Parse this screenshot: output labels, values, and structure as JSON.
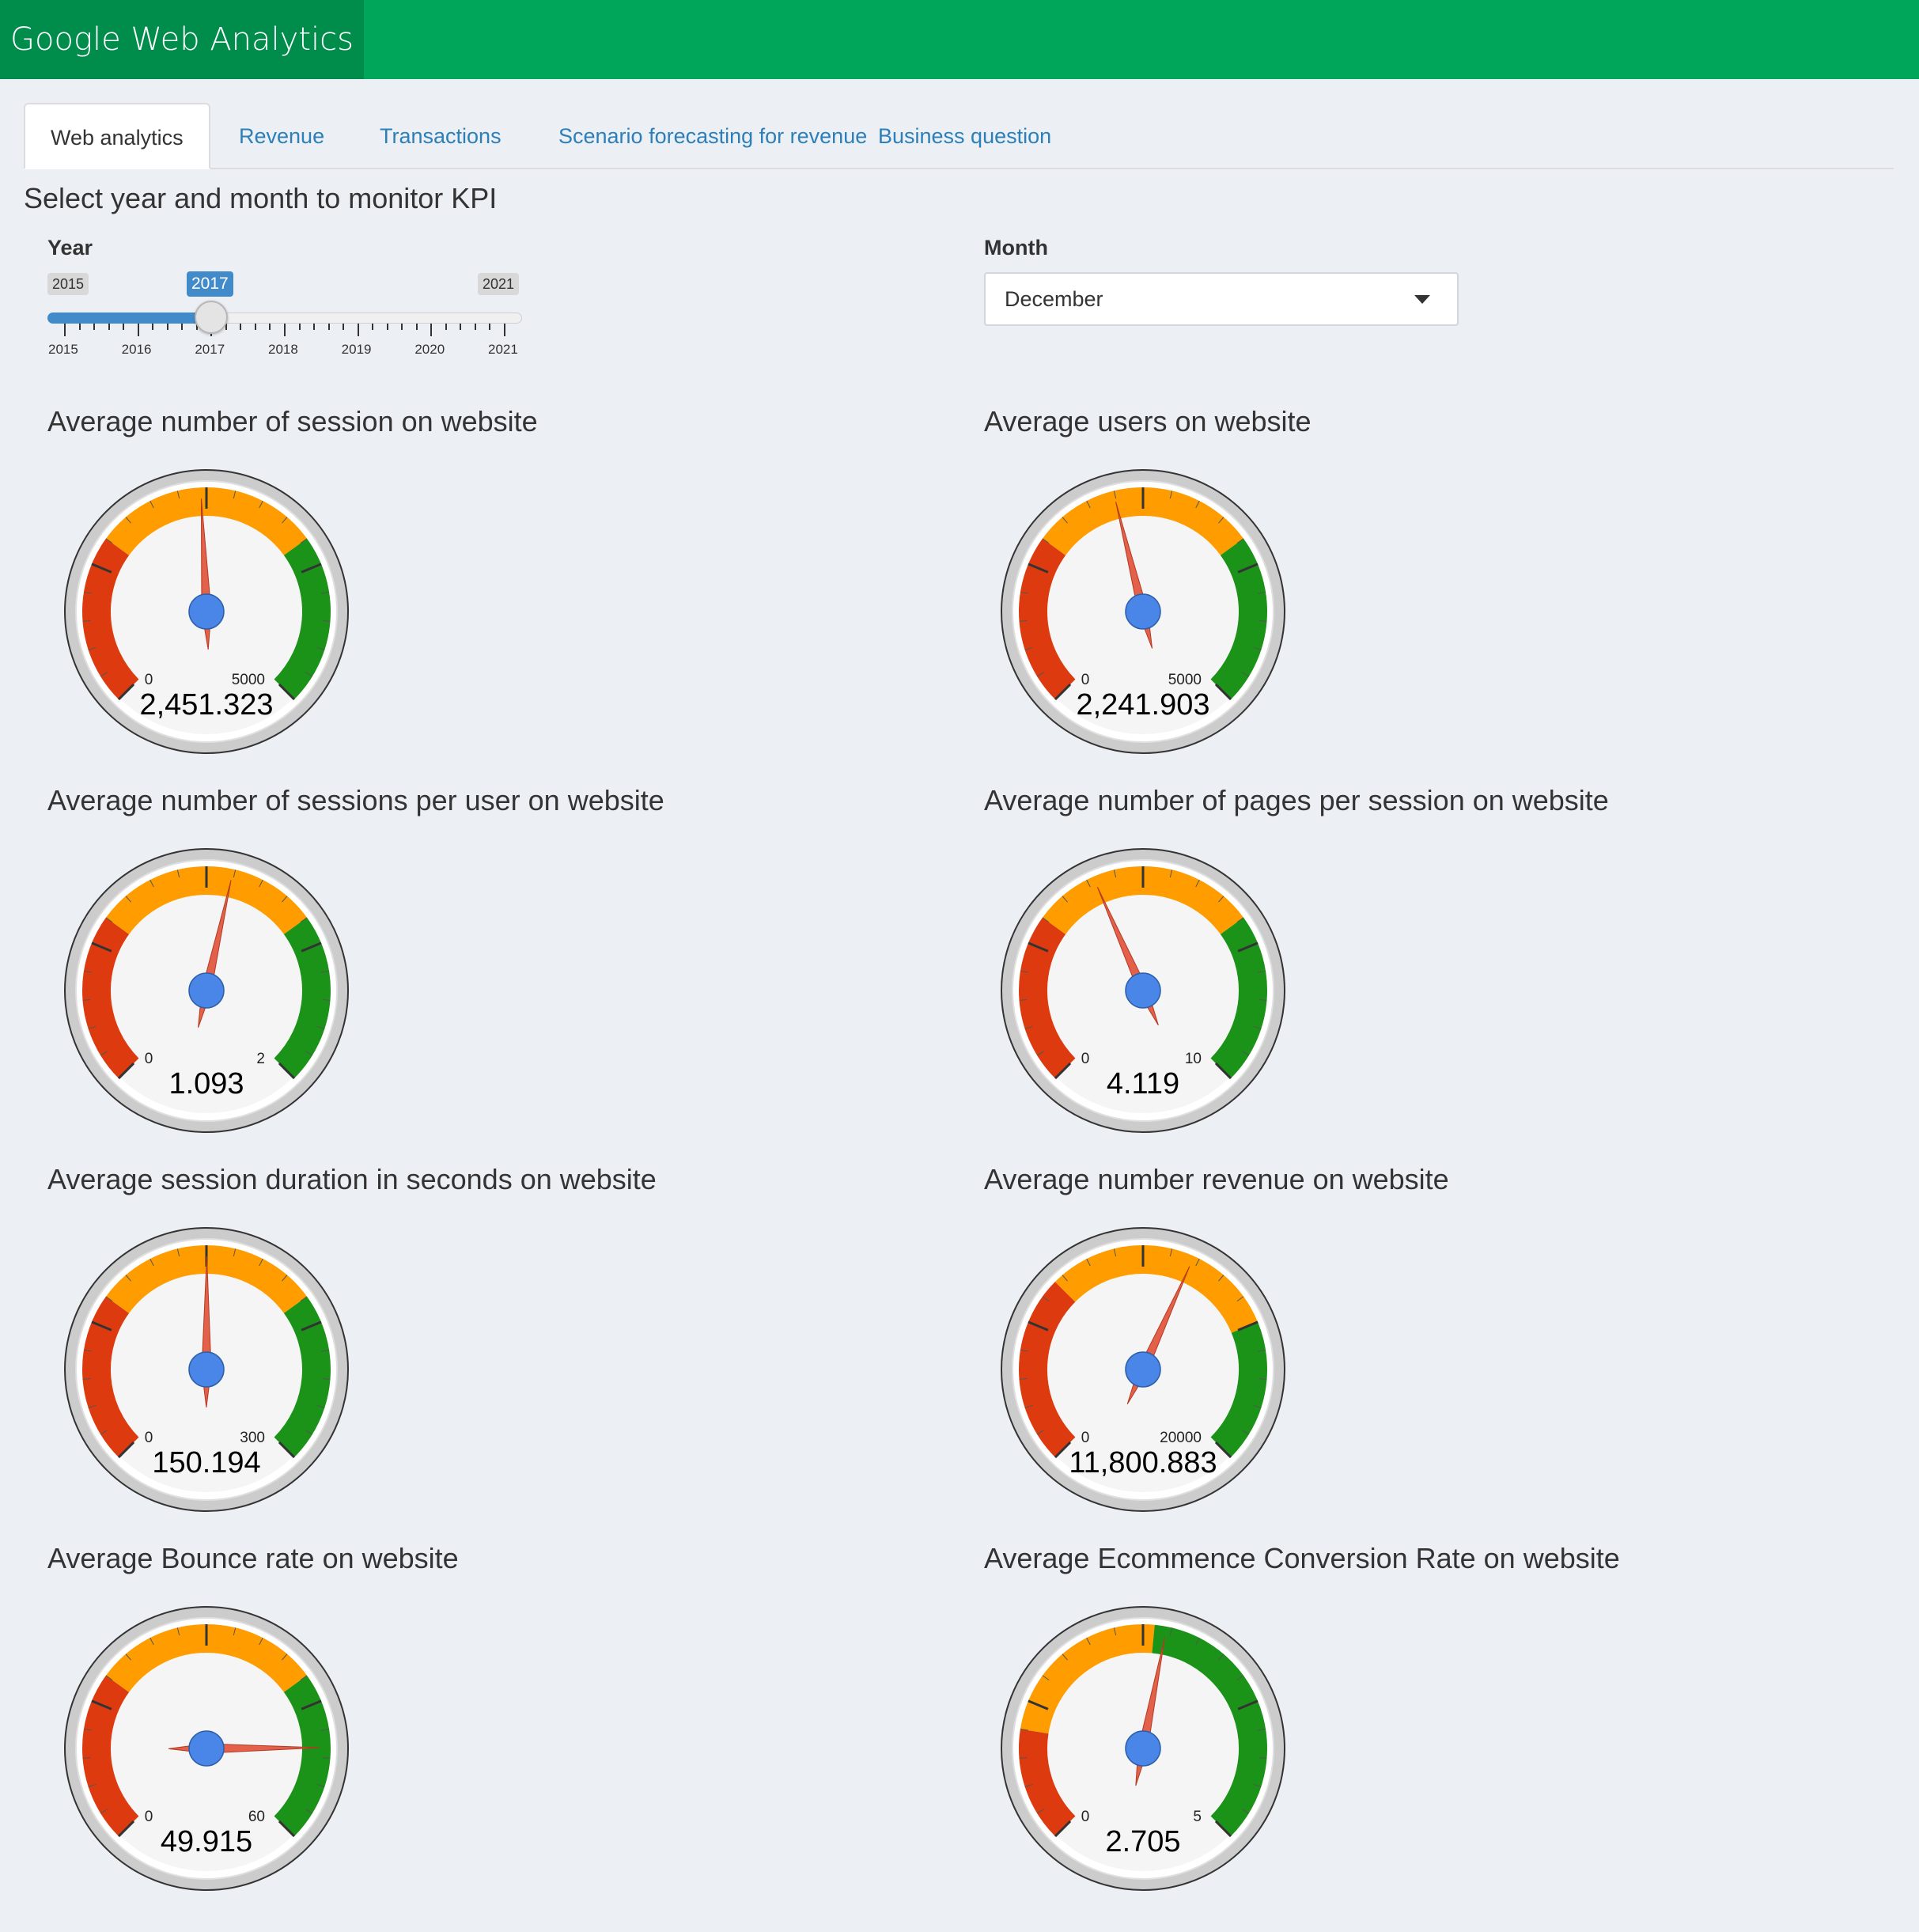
{
  "app": {
    "title": "Google Web Analytics"
  },
  "tabs": [
    {
      "label": "Web analytics",
      "active": true
    },
    {
      "label": "Revenue"
    },
    {
      "label": "Transactions"
    },
    {
      "label": "Scenario forecasting for revenue"
    },
    {
      "label": "Business question"
    }
  ],
  "controls": {
    "heading": "Select year and month to monitor KPI",
    "year": {
      "label": "Year",
      "min": "2015",
      "max": "2021",
      "selected": "2017",
      "ticks": [
        "2015",
        "2016",
        "2017",
        "2018",
        "2019",
        "2020",
        "2021"
      ]
    },
    "month": {
      "label": "Month",
      "selected": "December"
    }
  },
  "gauges": [
    {
      "title": "Average number of session on website",
      "min": "0",
      "max": "5000",
      "value": "2,451.323",
      "value_num": 2451.323,
      "max_num": 5000
    },
    {
      "title": "Average users on website",
      "min": "0",
      "max": "5000",
      "value": "2,241.903",
      "value_num": 2241.903,
      "max_num": 5000
    },
    {
      "title": "Average number of sessions per user on website",
      "min": "0",
      "max": "2",
      "value": "1.093",
      "value_num": 1.093,
      "max_num": 2
    },
    {
      "title": "Average number of pages per session on website",
      "min": "0",
      "max": "10",
      "value": "4.119",
      "value_num": 4.119,
      "max_num": 10
    },
    {
      "title": "Average session duration in seconds on website",
      "min": "0",
      "max": "300",
      "value": "150.194",
      "value_num": 150.194,
      "max_num": 300
    },
    {
      "title": "Average number revenue on website",
      "min": "0",
      "max": "20000",
      "value": "11,800.883",
      "value_num": 11800.883,
      "max_num": 20000,
      "bands": [
        0.333,
        0.75
      ]
    },
    {
      "title": "Average Bounce rate on website",
      "min": "0",
      "max": "60",
      "value": "49.915",
      "value_num": 49.915,
      "max_num": 60
    },
    {
      "title": "Average Ecommence Conversion Rate on website",
      "min": "0",
      "max": "5",
      "value": "2.705",
      "value_num": 2.705,
      "max_num": 5,
      "bands": [
        0.2,
        0.52
      ]
    }
  ],
  "colors": {
    "header": "#00a65a",
    "brand": "#008d4c",
    "danger": "#dd3b0f",
    "warning": "#ff9c00",
    "success": "#1b9218",
    "needle": "#e3604a",
    "hub": "#4a86e8"
  }
}
